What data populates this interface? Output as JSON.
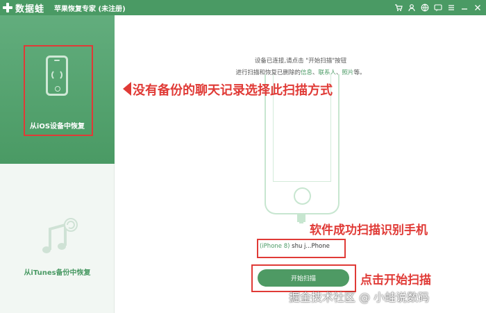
{
  "titlebar": {
    "logo": "数据蛙",
    "title": "苹果恢复专家 (未注册)",
    "icons": [
      "cart-icon",
      "user-icon",
      "globe-icon",
      "message-icon",
      "menu-icon",
      "minimize-icon",
      "close-icon"
    ]
  },
  "sidebar": {
    "items": [
      {
        "label": "从iOS设备中恢复",
        "icon": "phone-refresh-icon",
        "active": true
      },
      {
        "label": "从iTunes备份中恢复",
        "icon": "music-refresh-icon",
        "active": false
      }
    ]
  },
  "main": {
    "instruction_line1": "设备已连接,请点击 \"开始扫描\"按钮",
    "instruction_line2_prefix": "进行扫描和恢复已删除的",
    "instruction_info": "信息",
    "instruction_sep1": "、",
    "instruction_contacts": "联系人",
    "instruction_sep2": "、",
    "instruction_photos": "照片",
    "instruction_suffix": "等。",
    "device_model": "(iPhone 8)",
    "device_name": "shu j...Phone",
    "start_button": "开始扫描"
  },
  "annotations": {
    "note1": "没有备份的聊天记录选择此扫描方式",
    "note2": "软件成功扫描识别手机",
    "note3": "点击开始扫描",
    "watermark": "掘金技术社区 @ 小蛙说数码"
  },
  "colors": {
    "brand_green": "#4a9a64",
    "annotation_red": "#e03a36"
  }
}
